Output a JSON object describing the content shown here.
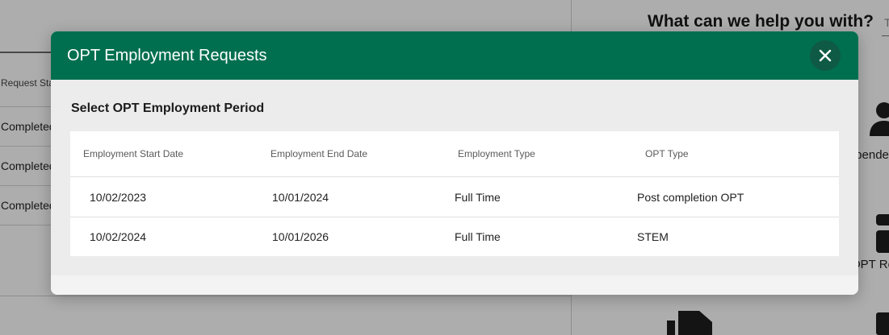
{
  "background": {
    "table": {
      "column_header": "Request Status",
      "rows": [
        "Completed",
        "Completed",
        "Completed"
      ]
    },
    "help": {
      "title": "What can we help you with?",
      "search_placeholder": "T",
      "tiles": [
        {
          "icon": "people-icon",
          "label": "Dependents"
        },
        {
          "icon": "id-badge-icon",
          "label": "OPT Requests"
        },
        {
          "icon": "documents-icon",
          "label": ""
        }
      ]
    }
  },
  "modal": {
    "title": "OPT Employment Requests",
    "close_icon": "close-icon",
    "section_title": "Select OPT Employment Period",
    "table": {
      "columns": [
        "Employment Start Date",
        "Employment End Date",
        "Employment Type",
        "OPT Type"
      ],
      "rows": [
        [
          "10/02/2023",
          "10/01/2024",
          "Full Time",
          "Post completion OPT"
        ],
        [
          "10/02/2024",
          "10/01/2026",
          "Full Time",
          "STEM"
        ]
      ]
    }
  },
  "colors": {
    "header_green": "#006f4f",
    "close_button_bg": "#0f5a44"
  }
}
